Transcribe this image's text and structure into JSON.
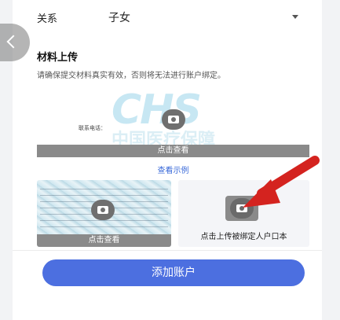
{
  "relation": {
    "label": "关系",
    "value": "子女"
  },
  "materials": {
    "title": "材料上传",
    "notice": "请确保提交材料真实有效，否则将无法进行账户绑定。",
    "sample": {
      "watermark_en": "CHS",
      "watermark_cn": "中国医疗保障",
      "phone_label": "联系电话：",
      "view_label": "点击查看"
    },
    "example_link": "查看示例",
    "id_card": {
      "view_label": "点击查看"
    },
    "household_upload": {
      "label": "点击上传被绑定人户口本"
    }
  },
  "add_button": "添加账户",
  "colors": {
    "primary": "#4c6fe0",
    "annotation_arrow": "#d4231f"
  }
}
